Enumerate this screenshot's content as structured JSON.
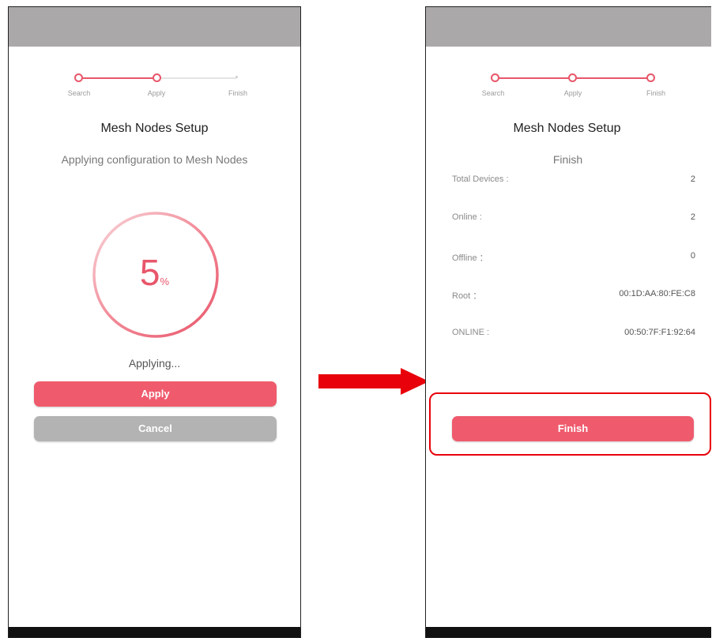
{
  "left_screen": {
    "steps": [
      "Search",
      "Apply",
      "Finish"
    ],
    "title": "Mesh Nodes Setup",
    "subtitle": "Applying configuration to Mesh Nodes",
    "progress_percent": 5,
    "progress_value": "5",
    "progress_unit": "%",
    "status_text": "Applying...",
    "apply_label": "Apply",
    "cancel_label": "Cancel"
  },
  "right_screen": {
    "steps": [
      "Search",
      "Apply",
      "Finish"
    ],
    "title": "Mesh Nodes Setup",
    "subtitle": "Finish",
    "rows": [
      {
        "label": "Total Devices :",
        "value": "2"
      },
      {
        "label": "Online :",
        "value": "2"
      },
      {
        "label": "Offline ：",
        "value": "0"
      },
      {
        "label": "Root ：",
        "value": "00:1D:AA:80:FE:C8"
      },
      {
        "label": "ONLINE :",
        "value": "00:50:7F:F1:92:64"
      }
    ],
    "finish_label": "Finish"
  },
  "colors": {
    "accent": "#ef5b6d",
    "cancel": "#b3b3b3",
    "highlight": "#e8000b",
    "arrow": "#e8000b"
  }
}
